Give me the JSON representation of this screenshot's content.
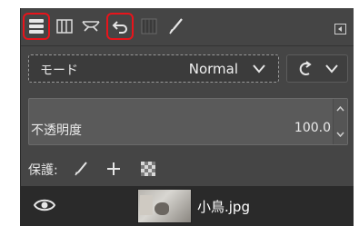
{
  "tabs": [
    {
      "icon": "layers-icon"
    },
    {
      "icon": "channels-icon"
    },
    {
      "icon": "paths-icon"
    },
    {
      "icon": "undo-history-icon"
    },
    {
      "icon": "gradients-icon"
    },
    {
      "icon": "brushes-icon"
    }
  ],
  "highlight_color": "#e8141b",
  "mode": {
    "label": "モード",
    "value": "Normal"
  },
  "opacity": {
    "label": "不透明度",
    "value": "100.0"
  },
  "lock": {
    "label": "保護:"
  },
  "layer": {
    "name": "小鳥.jpg"
  }
}
